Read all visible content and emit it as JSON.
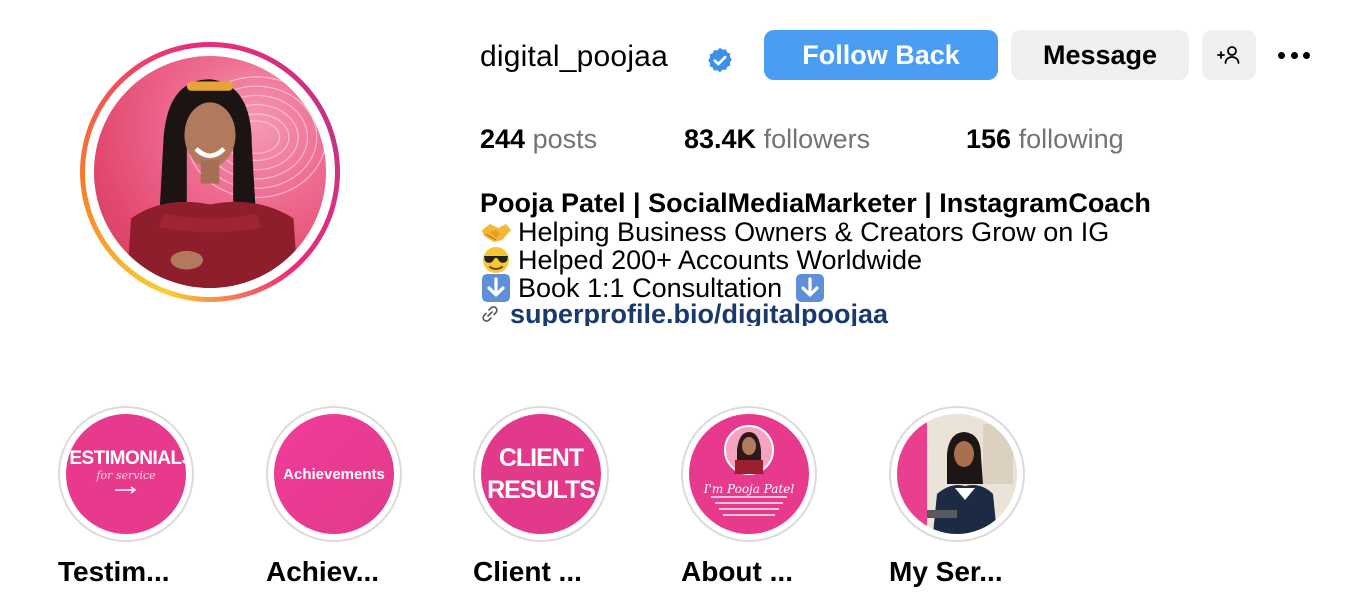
{
  "profile": {
    "username": "digital_poojaa",
    "verified": true
  },
  "actions": {
    "follow_back": "Follow Back",
    "message": "Message",
    "add_user_icon": "person-add-icon",
    "more_icon": "more-options-icon"
  },
  "stats": {
    "posts_count": "244",
    "posts_label": "posts",
    "followers_count": "83.4K",
    "followers_label": "followers",
    "following_count": "156",
    "following_label": "following"
  },
  "bio": {
    "name": "Pooja Patel | SocialMediaMarketer | InstagramCoach",
    "line1": "Helping Business Owners & Creators Grow on IG",
    "line2": "Helped 200+ Accounts Worldwide",
    "line3": "Book 1:1 Consultation",
    "link": "superprofile.bio/digitalpoojaa",
    "line1_emoji": "handshake-emoji",
    "line2_emoji": "sunglasses-emoji",
    "line3_emoji": "down-arrow-emoji"
  },
  "highlights": [
    {
      "label": "Testim...",
      "cover_text": "TESTIMONIALS",
      "cover_subtext": "for service"
    },
    {
      "label": "Achiev...",
      "cover_text": "Achievements"
    },
    {
      "label": "Client ...",
      "cover_text_line1": "CLIENT",
      "cover_text_line2": "RESULTS"
    },
    {
      "label": "About ...",
      "cover_text": "I'm Pooja Patel"
    },
    {
      "label": "My Ser..."
    }
  ],
  "colors": {
    "follow_button": "#4a9df3",
    "secondary_button": "#efefef",
    "link": "#1a3a6e",
    "muted": "#737373",
    "highlight_pink": "#e83a8d"
  }
}
